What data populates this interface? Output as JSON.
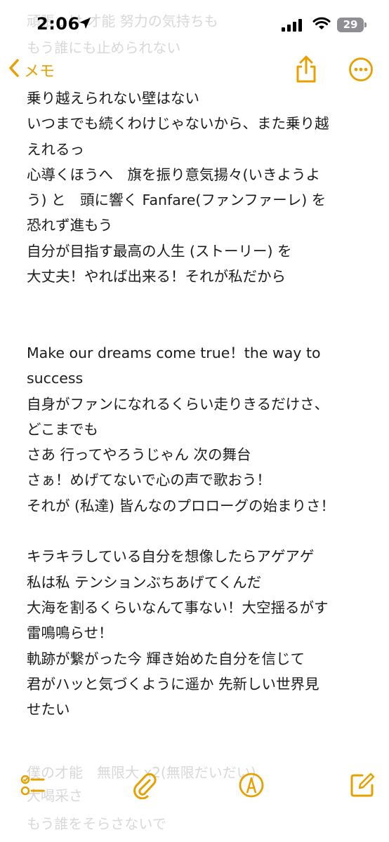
{
  "status": {
    "time": "2:06",
    "battery": "29",
    "behind_text": "頑張っけ 才能 努力の気持ちも",
    "behind_text2": "もう誰にも止められない"
  },
  "nav": {
    "back_label": "メモ"
  },
  "note": {
    "lines": [
      "乗り越えられない壁はない",
      "いつまでも続くわけじゃないから、また乗り越",
      "えれるっ",
      "心導くほうへ　旗を振り意気揚々(いきようよ",
      "う) と　頭に響く Fanfare(ファンファーレ) を",
      "恐れず進もう",
      "自分が目指す最高の人生 (ストーリー) を",
      "大丈夫！やれば出来る！それが私だから",
      "",
      "",
      "Make our dreams come true！the way to",
      "success",
      "自身がファンになれるくらい走りきるだけさ、",
      "どこまでも",
      "さあ 行ってやろうじゃん 次の舞台",
      "さぁ！めげてないで心の声で歌おう！",
      "それが (私達) 皆んなのプロローグの始まりさ！",
      "",
      "キラキラしている自分を想像したらアゲアゲ",
      "私は私  テンションぶちあげてくんだ",
      "大海を割るくらいなんて事ない！大空揺るがす",
      "雷鳴鳴らせ！",
      "軌跡が繋がった今 輝き始めた自分を信じて",
      "君がハッと気づくように遥か  先新しい世界見",
      "せたい"
    ],
    "behind_bottom_1": "僕の才能　無限大 x2(無限だいだい)",
    "behind_bottom_2": "大喝采さ",
    "behind_bottom_3": "もう誰をそらさないで"
  },
  "icons": {
    "accent": "#e6a000",
    "back": "chevron-left-icon",
    "share": "share-icon",
    "more": "more-ellipsis-icon",
    "checklist": "checklist-icon",
    "attach": "paperclip-icon",
    "markup": "markup-pen-icon",
    "compose": "compose-icon"
  }
}
